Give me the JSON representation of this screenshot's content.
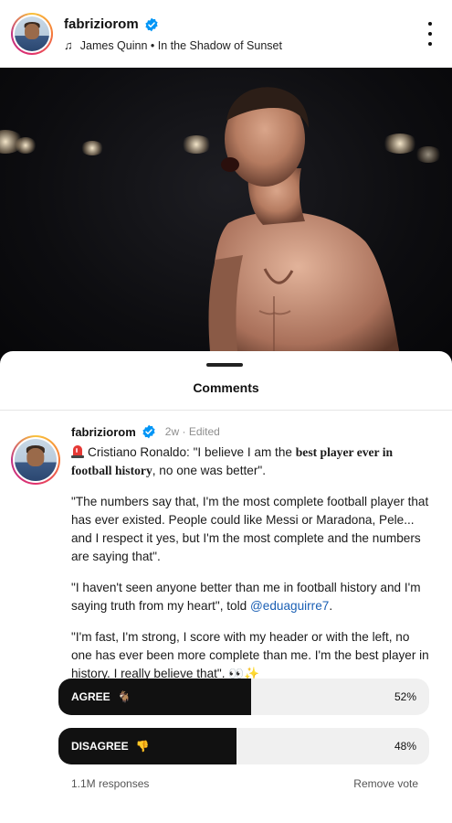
{
  "post": {
    "username": "fabriziorom",
    "music_artist": "James Quinn",
    "music_separator": "•",
    "music_track": "In the Shadow of Sunset"
  },
  "comments_sheet": {
    "title": "Comments"
  },
  "comment": {
    "username": "fabriziorom",
    "age": "2w",
    "meta_separator": "·",
    "edited": "Edited",
    "p1_start": "Cristiano Ronaldo: \"I believe I am the ",
    "p1_bold": "best player ever in football history",
    "p1_end": ", no one was better\".",
    "p2": "\"The numbers say that, I'm the most complete football player that has ever existed. People could like Messi or Maradona, Pele... and I respect it yes, but I'm the most complete and the numbers are saying that\".",
    "p3_start": "\"I haven't seen anyone better than me in football history and I'm saying truth from my heart\", told ",
    "p3_mention": "@eduaguirre7",
    "p3_end": ".",
    "p4": "\"I'm fast, I'm strong, I score with my header or with the left, no one has ever been more complete than me. I'm the best player in history. I really believe that\". 👀✨"
  },
  "poll": {
    "options": [
      {
        "label": "AGREE",
        "icon": "goat-icon",
        "glyph": "🐐",
        "percent_text": "52%",
        "percent": 52
      },
      {
        "label": "DISAGREE",
        "icon": "thumbs-down-icon",
        "glyph": "👎",
        "percent_text": "48%",
        "percent": 48
      }
    ],
    "responses": "1.1M responses",
    "remove_vote": "Remove vote"
  },
  "colors": {
    "verified": "#0095f6",
    "mention": "#1a5fb4",
    "poll_fill": "#111111",
    "poll_track": "#f0f0f0"
  }
}
